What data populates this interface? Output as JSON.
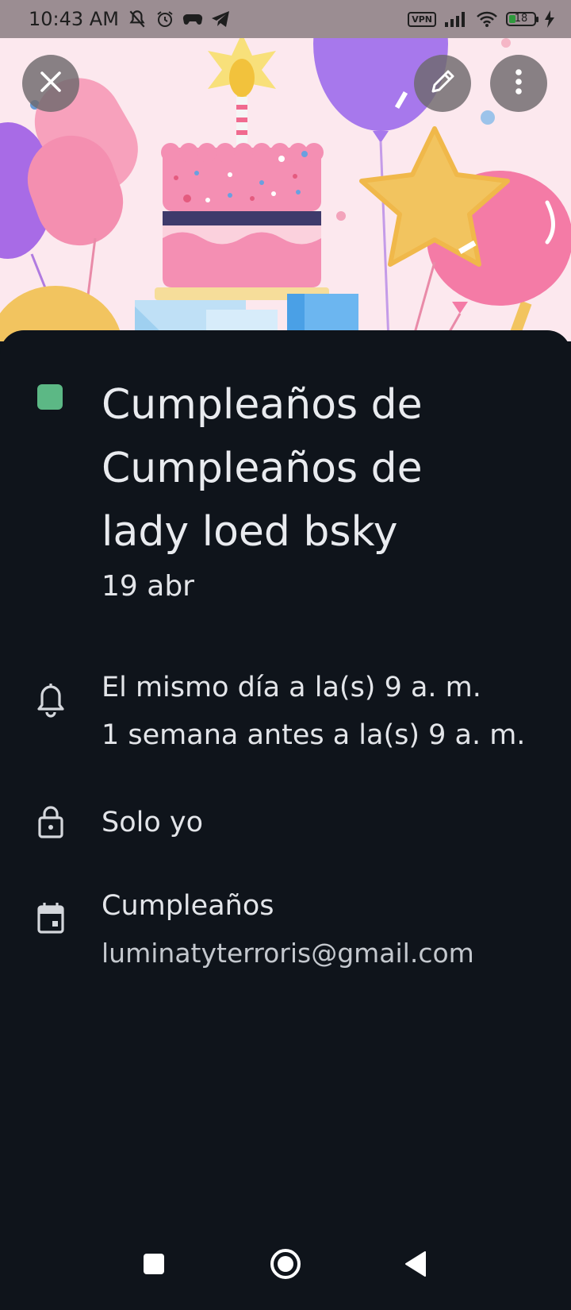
{
  "status_bar": {
    "time": "10:43 AM",
    "vpn_label": "VPN",
    "battery_level": "18",
    "icons": [
      "notifications-off-icon",
      "alarm-icon",
      "game-controller-icon",
      "telegram-icon",
      "vpn-icon",
      "signal-icon",
      "wifi-icon",
      "battery-icon",
      "charging-icon"
    ]
  },
  "header": {
    "close_icon": "close-icon",
    "edit_icon": "pencil-icon",
    "more_icon": "more-vert-icon",
    "illustration": "birthday-cake-illustration"
  },
  "event": {
    "color": "#5cb885",
    "title_lines": [
      "Cumpleaños de",
      "Cumpleaños de",
      "lady loed  bsky"
    ],
    "date": "19 abr"
  },
  "details": {
    "reminders": [
      "El mismo día a la(s) 9 a. m.",
      "1 semana antes a la(s) 9 a. m."
    ],
    "visibility": "Solo yo",
    "calendar_name": "Cumpleaños",
    "calendar_account": "luminatyterroris@gmail.com"
  },
  "nav": {
    "recents": "recents-square-icon",
    "home": "home-circle-icon",
    "back": "back-triangle-icon"
  }
}
